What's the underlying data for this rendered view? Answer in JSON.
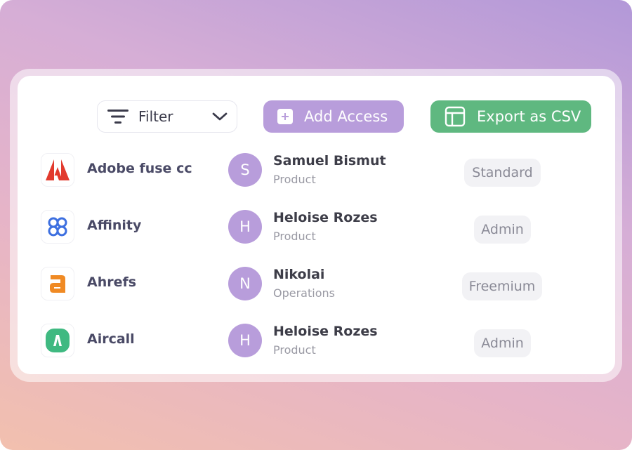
{
  "toolbar": {
    "filter_label": "Filter",
    "add_access_label": "Add Access",
    "export_label": "Export as CSV"
  },
  "colors": {
    "accent_purple": "#b89ddb",
    "accent_green": "#5fb880"
  },
  "rows": [
    {
      "app": {
        "name": "Adobe fuse cc",
        "logo": "adobe-logo-icon",
        "color": "#e23a2e"
      },
      "user": {
        "initial": "S",
        "name": "Samuel Bismut",
        "dept": "Product"
      },
      "access": "Standard"
    },
    {
      "app": {
        "name": "Affinity",
        "logo": "affinity-logo-icon",
        "color": "#3d6fe0"
      },
      "user": {
        "initial": "H",
        "name": "Heloise Rozes",
        "dept": "Product"
      },
      "access": "Admin"
    },
    {
      "app": {
        "name": "Ahrefs",
        "logo": "ahrefs-logo-icon",
        "color": "#f08a24"
      },
      "user": {
        "initial": "N",
        "name": "Nikolai",
        "dept": "Operations"
      },
      "access": "Freemium"
    },
    {
      "app": {
        "name": "Aircall",
        "logo": "aircall-logo-icon",
        "color": "#3fb981"
      },
      "user": {
        "initial": "H",
        "name": "Heloise Rozes",
        "dept": "Product"
      },
      "access": "Admin"
    }
  ]
}
